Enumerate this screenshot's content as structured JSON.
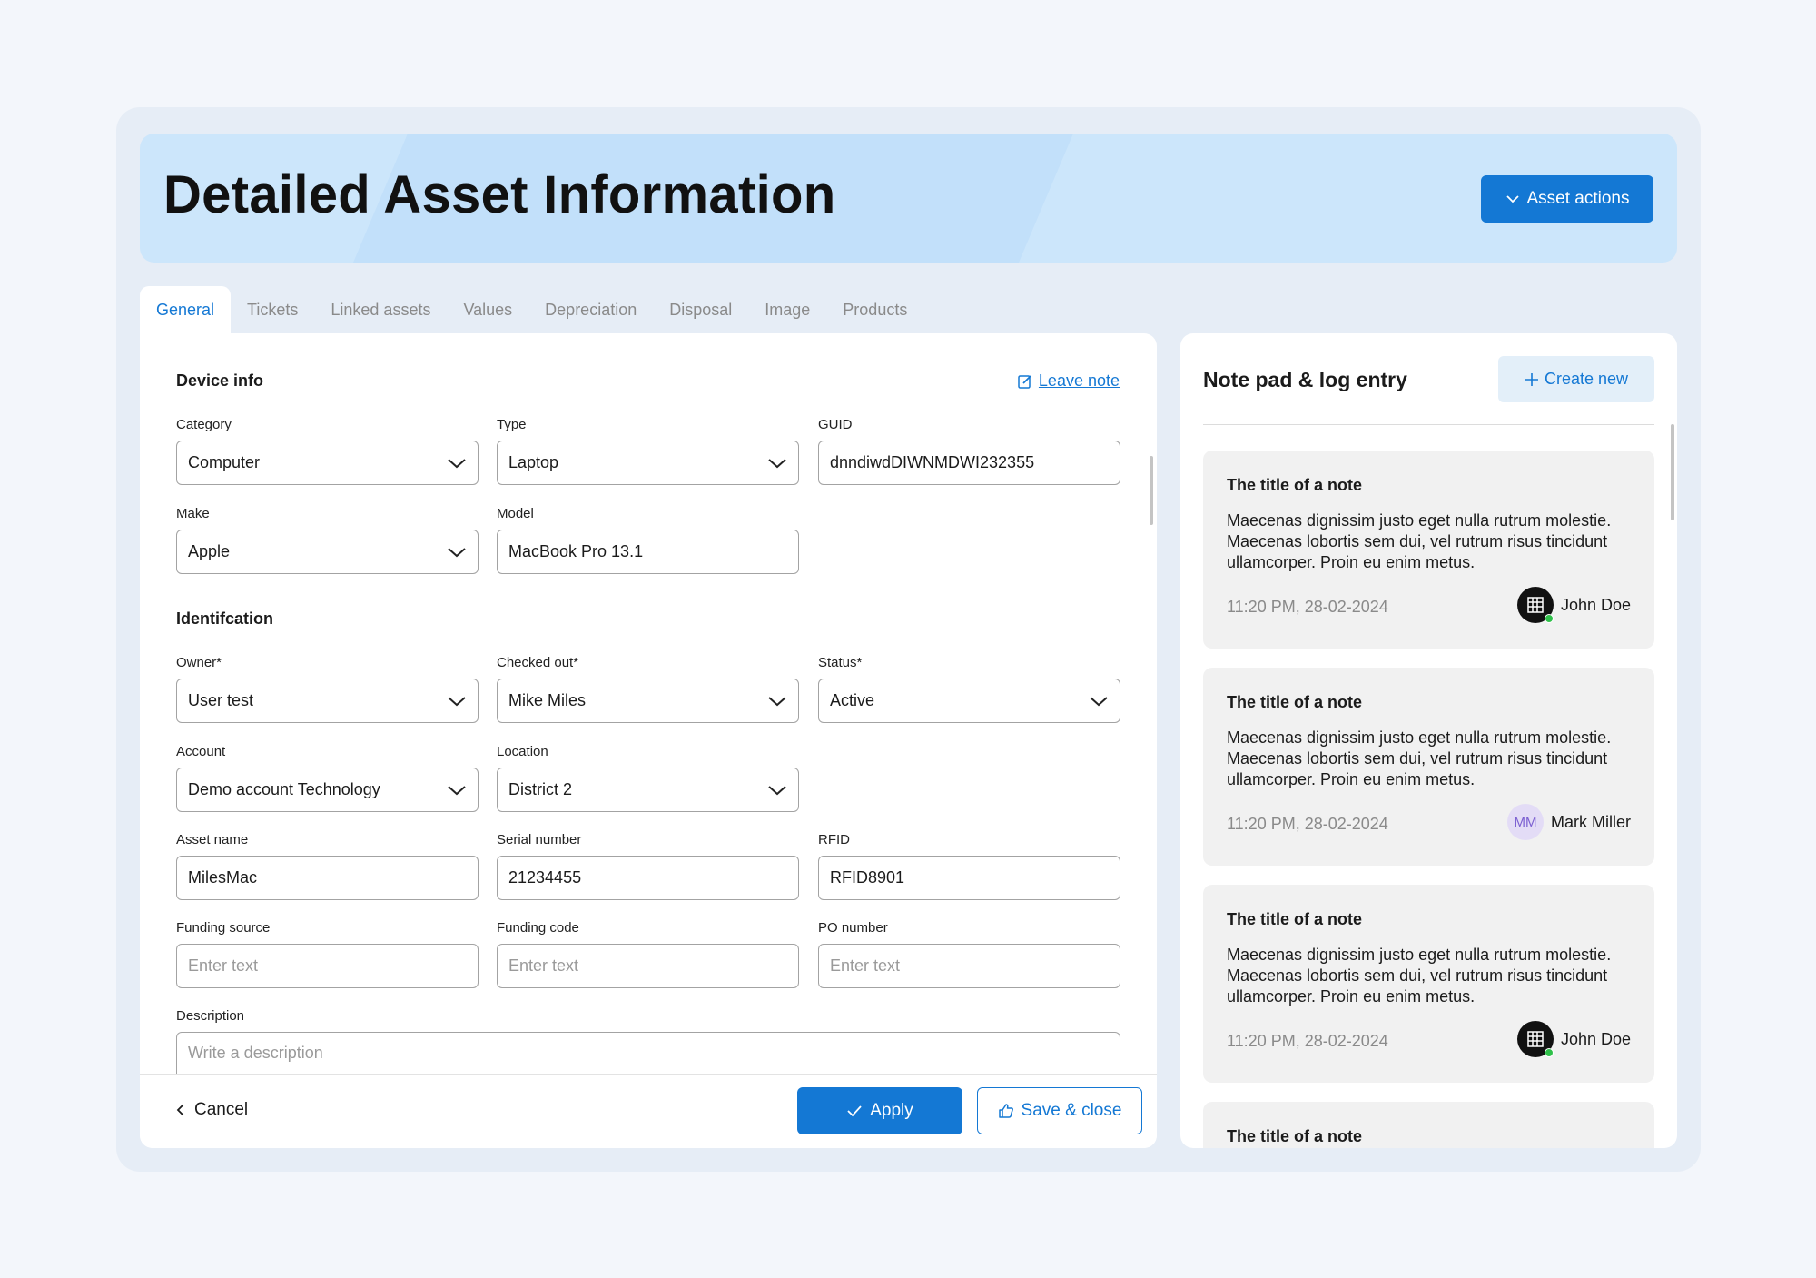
{
  "header": {
    "title": "Detailed Asset Information",
    "actions_label": "Asset actions"
  },
  "tabs": [
    "General",
    "Tickets",
    "Linked assets",
    "Values",
    "Depreciation",
    "Disposal",
    "Image",
    "Products"
  ],
  "device_info": {
    "title": "Device info",
    "leave_note": "Leave note",
    "category": {
      "label": "Category",
      "value": "Computer"
    },
    "type": {
      "label": "Type",
      "value": "Laptop"
    },
    "guid": {
      "label": "GUID",
      "value": "dnndiwdDIWNMDWI232355"
    },
    "make": {
      "label": "Make",
      "value": "Apple"
    },
    "model": {
      "label": "Model",
      "value": "MacBook Pro 13.1"
    }
  },
  "identification": {
    "title": "Identifcation",
    "owner": {
      "label": "Owner*",
      "value": "User test"
    },
    "checked_out": {
      "label": "Checked out*",
      "value": "Mike Miles"
    },
    "status": {
      "label": "Status*",
      "value": "Active"
    },
    "account": {
      "label": "Account",
      "value": "Demo account Technology"
    },
    "location": {
      "label": "Location",
      "value": "District 2"
    },
    "asset_name": {
      "label": "Asset name",
      "value": "MilesMac"
    },
    "serial": {
      "label": "Serial number",
      "value": "21234455"
    },
    "rfid": {
      "label": "RFID",
      "value": "RFID8901"
    },
    "funding_source": {
      "label": "Funding source",
      "placeholder": "Enter text"
    },
    "funding_code": {
      "label": "Funding code",
      "placeholder": "Enter text"
    },
    "po_number": {
      "label": "PO number",
      "placeholder": "Enter text"
    },
    "description": {
      "label": "Description",
      "placeholder": "Write a description"
    }
  },
  "footer": {
    "cancel": "Cancel",
    "apply": "Apply",
    "save_close": "Save & close"
  },
  "notepad": {
    "title": "Note pad & log entry",
    "create_new": "Create new",
    "notes": [
      {
        "title": "The title of a note",
        "body": "Maecenas dignissim justo eget nulla rutrum molestie. Maecenas lobortis sem dui, vel rutrum risus tincidunt ullamcorper. Proin eu enim metus.",
        "time": "11:20 PM, 28-02-2024",
        "author": "John Doe",
        "initials": ""
      },
      {
        "title": "The title of a note",
        "body": "Maecenas dignissim justo eget nulla rutrum molestie. Maecenas lobortis sem dui, vel rutrum risus tincidunt ullamcorper. Proin eu enim metus.",
        "time": "11:20 PM, 28-02-2024",
        "author": "Mark Miller",
        "initials": "MM"
      },
      {
        "title": "The title of a note",
        "body": "Maecenas dignissim justo eget nulla rutrum molestie. Maecenas lobortis sem dui, vel rutrum risus tincidunt ullamcorper. Proin eu enim metus.",
        "time": "11:20 PM, 28-02-2024",
        "author": "John Doe",
        "initials": ""
      },
      {
        "title": "The title of a note"
      }
    ]
  },
  "colors": {
    "accent": "#1478d4",
    "hero_bg": "#cce6fb",
    "frame_bg": "#e6edf6",
    "online": "#2fc04a"
  }
}
